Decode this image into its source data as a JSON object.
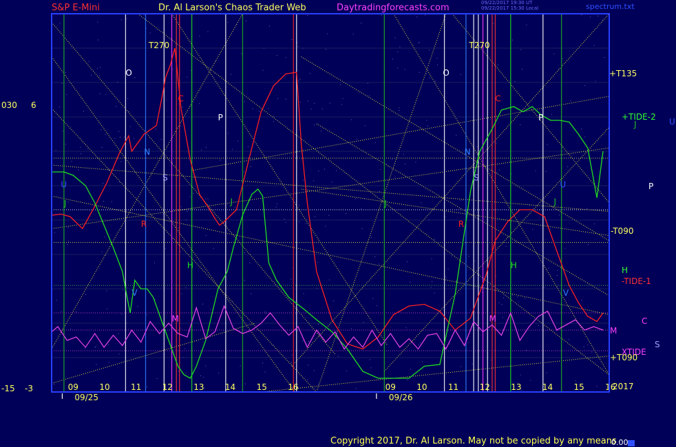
{
  "header": {
    "symbol": "S&P E-Mini",
    "title": "Dr. Al Larson's Chaos Trader Web",
    "site": "Daytradingforecasts.com",
    "stamp1": "09/22/2017 19:30 UT",
    "stamp2": "09/22/2017 15:30 Local",
    "file": "spectrum.txt"
  },
  "left_scale": {
    "a_top": "030",
    "b_top": "6",
    "a_bottom": "-15",
    "b_bottom": "-3"
  },
  "right_labels": {
    "t135": "+T135",
    "tide2": "+TIDE-2",
    "j": "J",
    "u": "U",
    "p": "P",
    "t090": "-T090",
    "h": "H",
    "tide1": "-TIDE-1",
    "c": "C",
    "m": "M",
    "s": "S",
    "xtide": "XTIDE",
    "t090b": "+T090",
    "year": "2017"
  },
  "copyright": "Copyright 2017, Dr. Al Larson. May not be copied by any means",
  "corner_value": "0.00",
  "colors": {
    "background": "#000058",
    "frame": "#2840ff",
    "red": "#ff2020",
    "green": "#20e020",
    "magenta": "#e040e0",
    "yellow": "#ffff40",
    "white": "#ffffff",
    "blue": "#3050ff"
  },
  "chart_data": {
    "type": "line",
    "days": [
      "09/25",
      "09/26"
    ],
    "x_ticks_day1": [
      "09",
      "10",
      "11",
      "12",
      "13",
      "14",
      "15",
      "16"
    ],
    "x_ticks_day2": [
      "09",
      "10",
      "11",
      "12",
      "13",
      "14",
      "15",
      "16"
    ],
    "day_markers": [
      {
        "label": "T270",
        "day": 1
      },
      {
        "label": "T270",
        "day": 2
      }
    ],
    "planet_markers": [
      {
        "letter": "O",
        "color": "#ffffff",
        "t": [
          0.8,
          11.1
        ]
      },
      {
        "letter": "C",
        "color": "#ff2020",
        "t": [
          2.5,
          12.8
        ]
      },
      {
        "letter": "P",
        "color": "#ffffff",
        "t": [
          3.8,
          14.2
        ]
      },
      {
        "letter": "N",
        "color": "#3080ff",
        "t": [
          1.4,
          11.8
        ]
      },
      {
        "letter": "S",
        "color": "#a0a0ff",
        "t": [
          2.0,
          12.1
        ]
      },
      {
        "letter": "J",
        "color": "#20c020",
        "t": [
          -1.2,
          4.2,
          9.2,
          14.7
        ]
      },
      {
        "letter": "R",
        "color": "#ff2020",
        "t": [
          1.3,
          11.6
        ]
      },
      {
        "letter": "H",
        "color": "#20e020",
        "t": [
          2.8,
          13.3
        ]
      },
      {
        "letter": "M",
        "color": "#ff40ff",
        "t": [
          2.3,
          12.6
        ]
      },
      {
        "letter": "V",
        "color": "#3080ff",
        "t": [
          1.0,
          15.0
        ]
      },
      {
        "letter": "U",
        "color": "#3050ff",
        "t": [
          -1.3,
          14.9
        ]
      }
    ],
    "series": [
      {
        "name": "TIDE-1",
        "color": "#ff2020",
        "x": [
          -1.6,
          -1.3,
          -1.0,
          -0.6,
          -0.2,
          0.2,
          0.6,
          0.9,
          1.0,
          1.4,
          1.8,
          2.0,
          2.1,
          2.25,
          2.4,
          2.6,
          2.9,
          3.2,
          3.5,
          3.7,
          3.85,
          4.0,
          4.4,
          4.8,
          5.2,
          5.6,
          6.0,
          6.35,
          6.5,
          6.7,
          7.0,
          7.5,
          8.0,
          8.5,
          9.0,
          9.5,
          10.0,
          10.5,
          11.0,
          11.5,
          12.0,
          12.5,
          12.8,
          13.2,
          13.6,
          14.0,
          14.4,
          14.8,
          15.2,
          15.5,
          15.8,
          16.1,
          16.3
        ],
        "y": [
          0.28,
          0.35,
          0.2,
          -0.5,
          0.8,
          2.2,
          3.9,
          4.9,
          4.0,
          5.0,
          5.5,
          7.3,
          8.3,
          9.0,
          10.0,
          6.5,
          3.5,
          1.5,
          0.7,
          0.1,
          -0.3,
          -0.1,
          0.6,
          3.5,
          6.3,
          7.8,
          8.5,
          8.6,
          4.5,
          1.0,
          -3.0,
          -5.8,
          -7.2,
          -7.5,
          -6.8,
          -5.5,
          -5.0,
          -4.9,
          -5.3,
          -6.4,
          -5.7,
          -3.2,
          -1.2,
          -0.1,
          0.6,
          0.6,
          0.2,
          -1.8,
          -3.8,
          -4.8,
          -5.6,
          -5.9,
          -5.4
        ]
      },
      {
        "name": "TIDE-2",
        "color": "#20e020",
        "x": [
          -1.6,
          -1.2,
          -0.9,
          -0.5,
          -0.2,
          0.1,
          0.4,
          0.7,
          0.85,
          0.95,
          1.1,
          1.3,
          1.5,
          1.7,
          1.9,
          2.1,
          2.3,
          2.5,
          2.7,
          2.9,
          3.1,
          3.4,
          3.6,
          3.8,
          4.1,
          4.3,
          4.6,
          4.9,
          5.1,
          5.25,
          5.45,
          5.7,
          6.1,
          6.6,
          7.0,
          7.5,
          8.0,
          8.5,
          9.0,
          9.5,
          10.0,
          10.5,
          11.0,
          11.5,
          12.0,
          12.3,
          12.7,
          13.0,
          13.4,
          13.7,
          14.0,
          14.3,
          14.6,
          14.9,
          15.2,
          15.5,
          15.8,
          16.1,
          16.3
        ],
        "y": [
          2.8,
          2.8,
          2.6,
          2.0,
          1.0,
          -0.3,
          -1.6,
          -3.0,
          -4.5,
          -5.4,
          -3.5,
          -4.0,
          -4.0,
          -4.5,
          -5.5,
          -6.5,
          -7.5,
          -8.5,
          -9.0,
          -9.2,
          -8.5,
          -7.0,
          -5.5,
          -4.0,
          -3.0,
          -1.6,
          0.3,
          1.5,
          1.8,
          1.4,
          -2.5,
          -3.5,
          -4.5,
          -5.2,
          -5.8,
          -6.5,
          -7.5,
          -8.8,
          -9.2,
          -9.2,
          -9.2,
          -8.5,
          -8.4,
          -4.3,
          1.7,
          4.0,
          5.3,
          6.4,
          6.6,
          6.3,
          6.6,
          6.1,
          5.8,
          5.8,
          5.7,
          5.0,
          4.2,
          1.3,
          4.0
        ]
      },
      {
        "name": "XTIDE",
        "color": "#e040e0",
        "x": [
          -1.6,
          -1.4,
          -1.1,
          -0.8,
          -0.5,
          -0.2,
          0.1,
          0.4,
          0.7,
          1.0,
          1.3,
          1.6,
          1.9,
          2.2,
          2.5,
          2.8,
          3.1,
          3.4,
          3.7,
          4.0,
          4.3,
          4.6,
          4.9,
          5.2,
          5.5,
          5.8,
          6.1,
          6.4,
          6.7,
          7.0,
          7.3,
          7.6,
          7.9,
          8.2,
          8.5,
          8.8,
          9.1,
          9.4,
          9.7,
          10.0,
          10.3,
          10.6,
          10.9,
          11.2,
          11.5,
          11.8,
          12.1,
          12.4,
          12.7,
          13.0,
          13.3,
          13.6,
          13.9,
          14.2,
          14.5,
          14.8,
          15.1,
          15.4,
          15.7,
          16.0,
          16.3
        ],
        "y": [
          -6.5,
          -6.2,
          -7.0,
          -6.8,
          -7.4,
          -6.6,
          -7.4,
          -6.7,
          -7.3,
          -6.4,
          -7.1,
          -5.9,
          -6.6,
          -6.0,
          -6.6,
          -6.8,
          -5.1,
          -6.9,
          -6.5,
          -5.0,
          -6.3,
          -6.6,
          -6.4,
          -6.0,
          -5.4,
          -6.1,
          -6.7,
          -6.2,
          -7.4,
          -6.4,
          -7.1,
          -6.5,
          -7.5,
          -6.8,
          -7.4,
          -6.4,
          -7.3,
          -6.6,
          -7.4,
          -6.9,
          -7.5,
          -6.7,
          -6.6,
          -7.5,
          -6.4,
          -7.3,
          -5.9,
          -6.5,
          -6.1,
          -6.7,
          -5.4,
          -7.0,
          -6.2,
          -5.6,
          -5.3,
          -6.4,
          -6.1,
          -5.8,
          -6.4,
          -6.2,
          -6.4
        ]
      }
    ],
    "xlim": [
      -1.6,
      16.5
    ],
    "ylim": [
      -10,
      12
    ]
  }
}
